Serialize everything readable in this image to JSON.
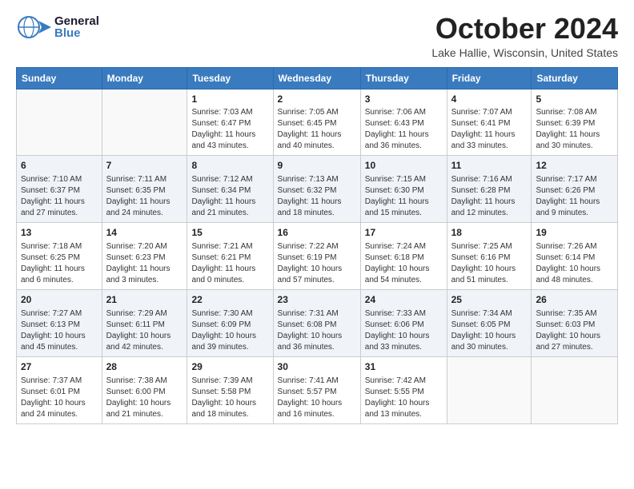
{
  "header": {
    "logo_general": "General",
    "logo_blue": "Blue",
    "month": "October 2024",
    "location": "Lake Hallie, Wisconsin, United States"
  },
  "days_of_week": [
    "Sunday",
    "Monday",
    "Tuesday",
    "Wednesday",
    "Thursday",
    "Friday",
    "Saturday"
  ],
  "weeks": [
    [
      {
        "day": "",
        "info": ""
      },
      {
        "day": "",
        "info": ""
      },
      {
        "day": "1",
        "info": "Sunrise: 7:03 AM\nSunset: 6:47 PM\nDaylight: 11 hours and 43 minutes."
      },
      {
        "day": "2",
        "info": "Sunrise: 7:05 AM\nSunset: 6:45 PM\nDaylight: 11 hours and 40 minutes."
      },
      {
        "day": "3",
        "info": "Sunrise: 7:06 AM\nSunset: 6:43 PM\nDaylight: 11 hours and 36 minutes."
      },
      {
        "day": "4",
        "info": "Sunrise: 7:07 AM\nSunset: 6:41 PM\nDaylight: 11 hours and 33 minutes."
      },
      {
        "day": "5",
        "info": "Sunrise: 7:08 AM\nSunset: 6:39 PM\nDaylight: 11 hours and 30 minutes."
      }
    ],
    [
      {
        "day": "6",
        "info": "Sunrise: 7:10 AM\nSunset: 6:37 PM\nDaylight: 11 hours and 27 minutes."
      },
      {
        "day": "7",
        "info": "Sunrise: 7:11 AM\nSunset: 6:35 PM\nDaylight: 11 hours and 24 minutes."
      },
      {
        "day": "8",
        "info": "Sunrise: 7:12 AM\nSunset: 6:34 PM\nDaylight: 11 hours and 21 minutes."
      },
      {
        "day": "9",
        "info": "Sunrise: 7:13 AM\nSunset: 6:32 PM\nDaylight: 11 hours and 18 minutes."
      },
      {
        "day": "10",
        "info": "Sunrise: 7:15 AM\nSunset: 6:30 PM\nDaylight: 11 hours and 15 minutes."
      },
      {
        "day": "11",
        "info": "Sunrise: 7:16 AM\nSunset: 6:28 PM\nDaylight: 11 hours and 12 minutes."
      },
      {
        "day": "12",
        "info": "Sunrise: 7:17 AM\nSunset: 6:26 PM\nDaylight: 11 hours and 9 minutes."
      }
    ],
    [
      {
        "day": "13",
        "info": "Sunrise: 7:18 AM\nSunset: 6:25 PM\nDaylight: 11 hours and 6 minutes."
      },
      {
        "day": "14",
        "info": "Sunrise: 7:20 AM\nSunset: 6:23 PM\nDaylight: 11 hours and 3 minutes."
      },
      {
        "day": "15",
        "info": "Sunrise: 7:21 AM\nSunset: 6:21 PM\nDaylight: 11 hours and 0 minutes."
      },
      {
        "day": "16",
        "info": "Sunrise: 7:22 AM\nSunset: 6:19 PM\nDaylight: 10 hours and 57 minutes."
      },
      {
        "day": "17",
        "info": "Sunrise: 7:24 AM\nSunset: 6:18 PM\nDaylight: 10 hours and 54 minutes."
      },
      {
        "day": "18",
        "info": "Sunrise: 7:25 AM\nSunset: 6:16 PM\nDaylight: 10 hours and 51 minutes."
      },
      {
        "day": "19",
        "info": "Sunrise: 7:26 AM\nSunset: 6:14 PM\nDaylight: 10 hours and 48 minutes."
      }
    ],
    [
      {
        "day": "20",
        "info": "Sunrise: 7:27 AM\nSunset: 6:13 PM\nDaylight: 10 hours and 45 minutes."
      },
      {
        "day": "21",
        "info": "Sunrise: 7:29 AM\nSunset: 6:11 PM\nDaylight: 10 hours and 42 minutes."
      },
      {
        "day": "22",
        "info": "Sunrise: 7:30 AM\nSunset: 6:09 PM\nDaylight: 10 hours and 39 minutes."
      },
      {
        "day": "23",
        "info": "Sunrise: 7:31 AM\nSunset: 6:08 PM\nDaylight: 10 hours and 36 minutes."
      },
      {
        "day": "24",
        "info": "Sunrise: 7:33 AM\nSunset: 6:06 PM\nDaylight: 10 hours and 33 minutes."
      },
      {
        "day": "25",
        "info": "Sunrise: 7:34 AM\nSunset: 6:05 PM\nDaylight: 10 hours and 30 minutes."
      },
      {
        "day": "26",
        "info": "Sunrise: 7:35 AM\nSunset: 6:03 PM\nDaylight: 10 hours and 27 minutes."
      }
    ],
    [
      {
        "day": "27",
        "info": "Sunrise: 7:37 AM\nSunset: 6:01 PM\nDaylight: 10 hours and 24 minutes."
      },
      {
        "day": "28",
        "info": "Sunrise: 7:38 AM\nSunset: 6:00 PM\nDaylight: 10 hours and 21 minutes."
      },
      {
        "day": "29",
        "info": "Sunrise: 7:39 AM\nSunset: 5:58 PM\nDaylight: 10 hours and 18 minutes."
      },
      {
        "day": "30",
        "info": "Sunrise: 7:41 AM\nSunset: 5:57 PM\nDaylight: 10 hours and 16 minutes."
      },
      {
        "day": "31",
        "info": "Sunrise: 7:42 AM\nSunset: 5:55 PM\nDaylight: 10 hours and 13 minutes."
      },
      {
        "day": "",
        "info": ""
      },
      {
        "day": "",
        "info": ""
      }
    ]
  ]
}
